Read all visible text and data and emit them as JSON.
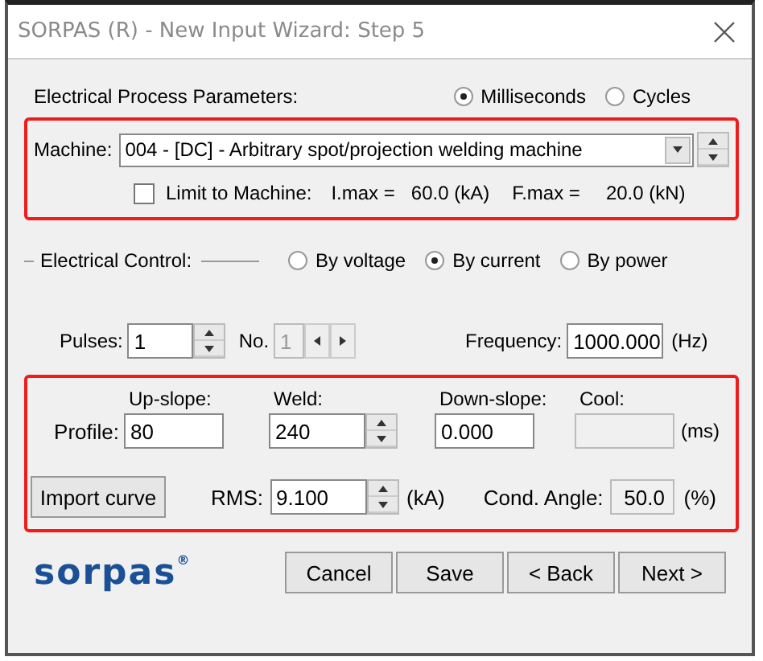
{
  "window": {
    "title": "SORPAS (R) - New Input Wizard: Step 5"
  },
  "time_unit": {
    "label": "Electrical Process Parameters:",
    "options": [
      {
        "label": "Milliseconds",
        "selected": true
      },
      {
        "label": "Cycles",
        "selected": false
      }
    ]
  },
  "machine": {
    "label": "Machine:",
    "value": "004 - [DC] - Arbitrary spot/projection welding machine",
    "limit": {
      "label": "Limit to Machine:",
      "checked": false
    },
    "imax_label": "I.max =",
    "imax": "60.0 (kA)",
    "fmax_label": "F.max =",
    "fmax": "20.0 (kN)"
  },
  "control": {
    "label": "Electrical Control:",
    "options": [
      {
        "label": "By voltage",
        "selected": false
      },
      {
        "label": "By current",
        "selected": true
      },
      {
        "label": "By power",
        "selected": false
      }
    ]
  },
  "pulses": {
    "label": "Pulses:",
    "value": "1",
    "no_label": "No.",
    "no_value": "1",
    "frequency_label": "Frequency:",
    "frequency": "1000.000",
    "frequency_unit": "(Hz)"
  },
  "profile": {
    "label": "Profile:",
    "unit": "(ms)",
    "fields": [
      {
        "heading": "Up-slope:",
        "value": "80",
        "spinner": false,
        "disabled": false
      },
      {
        "heading": "Weld:",
        "value": "240",
        "spinner": true,
        "disabled": false
      },
      {
        "heading": "Down-slope:",
        "value": "0.000",
        "spinner": false,
        "disabled": false
      },
      {
        "heading": "Cool:",
        "spinner": false,
        "disabled": true
      }
    ]
  },
  "import_button": "Import curve",
  "rms": {
    "label": "RMS:",
    "value": "9.100",
    "unit": "(kA)"
  },
  "cond_angle": {
    "label": "Cond. Angle:",
    "value": "50.0",
    "unit": "(%)"
  },
  "logo": "sorpas$^{®}$",
  "buttons": [
    "Cancel",
    "Save",
    "< Back",
    "Next >"
  ]
}
